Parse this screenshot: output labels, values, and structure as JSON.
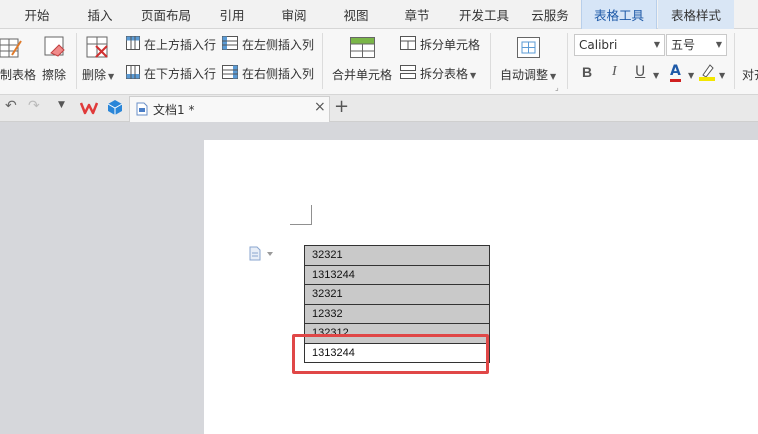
{
  "menu": {
    "tabs": [
      "开始",
      "插入",
      "页面布局",
      "引用",
      "审阅",
      "视图",
      "章节",
      "开发工具",
      "云服务",
      "表格工具",
      "表格样式"
    ],
    "active": "表格工具"
  },
  "ribbon": {
    "draw_table": "制表格",
    "erase": "擦除",
    "delete": "删除",
    "insert_above": "在上方插入行",
    "insert_below": "在下方插入行",
    "insert_left": "在左侧插入列",
    "insert_right": "在右侧插入列",
    "merge_cells": "合并单元格",
    "split_cells": "拆分单元格",
    "split_table": "拆分表格",
    "auto_fit": "自动调整",
    "font_name": "Calibri",
    "font_size": "五号",
    "bold": "B",
    "italic": "I",
    "underline": "U",
    "font_color": "A",
    "align": "对齐"
  },
  "doc_tab": {
    "title": "文档1 *",
    "close": "×",
    "new": "+"
  },
  "table": {
    "rows": [
      "32321",
      "1313244",
      "32321",
      "12332",
      "132312",
      "1313244"
    ]
  },
  "colors": {
    "accent": "#1f5aa8",
    "highlight_box": "#e04747",
    "selected_cell": "#c9c9c9"
  }
}
